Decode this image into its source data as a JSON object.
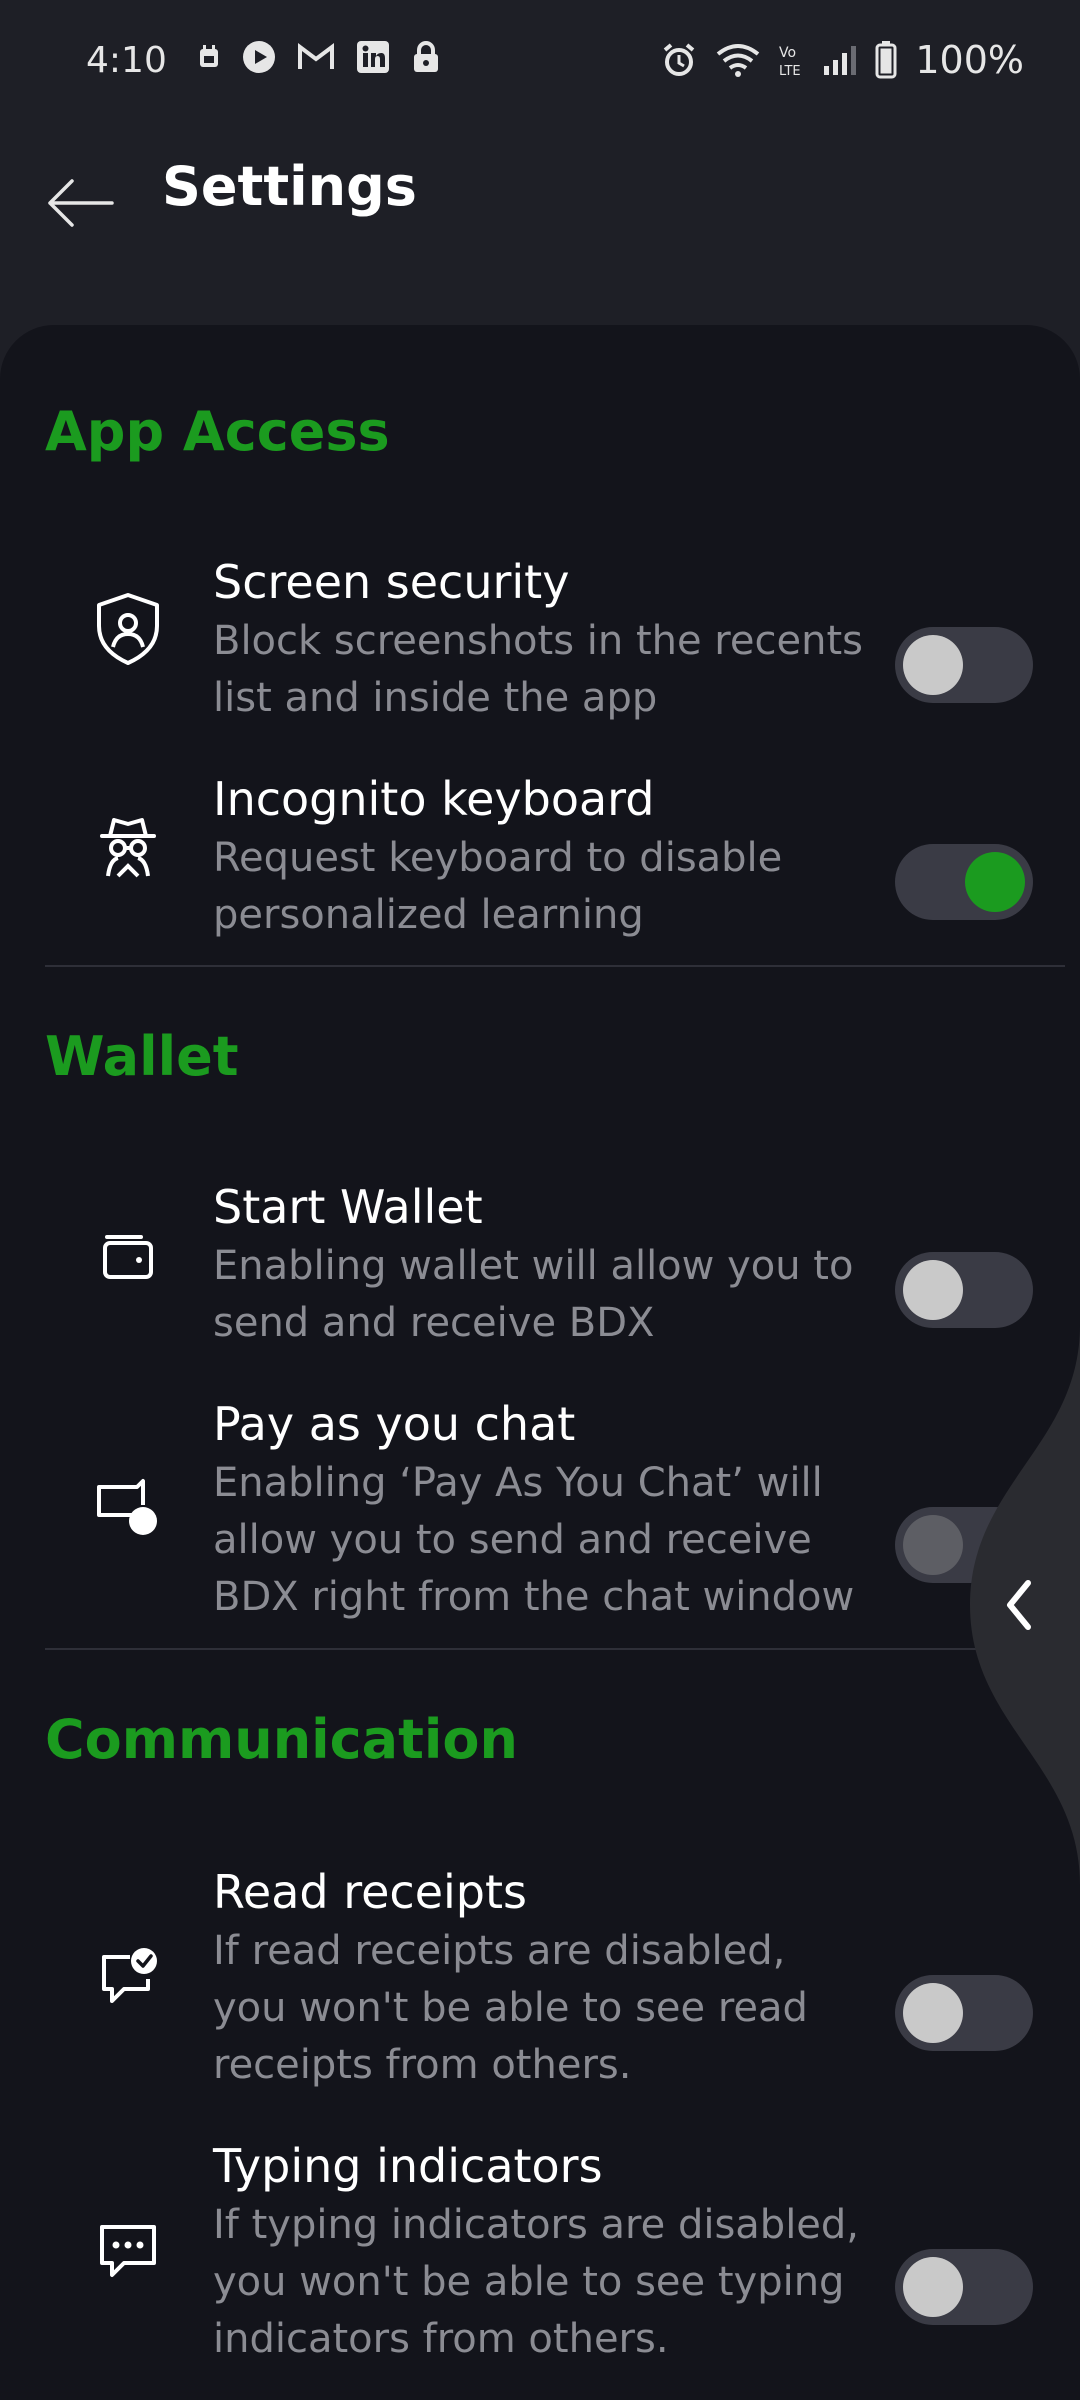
{
  "status_bar": {
    "time": "4:10",
    "notification_icons": [
      "calendar-icon",
      "youtube-icon",
      "gmail-icon",
      "linkedin-icon",
      "lock-icon"
    ],
    "system_icons": [
      "alarm-icon",
      "wifi-icon",
      "volte-icon",
      "signal-icon",
      "battery-icon"
    ],
    "battery": "100%"
  },
  "header": {
    "title": "Settings",
    "back_icon": "arrow-left-icon"
  },
  "sections": [
    {
      "title": "App Access",
      "items": [
        {
          "icon": "shield-user-icon",
          "title": "Screen security",
          "description": "Block screenshots in the recents\nlist and inside the app",
          "toggle": false
        },
        {
          "icon": "incognito-icon",
          "title": "Incognito keyboard",
          "description": "Request keyboard to disable\npersonalized learning",
          "toggle": true
        }
      ]
    },
    {
      "title": "Wallet",
      "items": [
        {
          "icon": "wallet-icon",
          "title": "Start Wallet",
          "description": "Enabling wallet will allow you to\nsend and receive BDX",
          "toggle": false
        },
        {
          "icon": "pay-chat-icon",
          "title": "Pay as you chat",
          "description": "Enabling ‘Pay As You Chat’ will\nallow you to send and receive\nBDX right from the chat window",
          "toggle": false,
          "disabled": true
        }
      ]
    },
    {
      "title": "Communication",
      "items": [
        {
          "icon": "read-receipt-icon",
          "title": "Read receipts",
          "description": "If read receipts are disabled,\nyou won't be able to see read\nreceipts from others.",
          "toggle": false
        },
        {
          "icon": "typing-icon",
          "title": "Typing indicators",
          "description": "If typing indicators are disabled,\nyou won't be able to see typing\nindicators from others.",
          "toggle": false
        }
      ]
    }
  ],
  "edge_panel": {
    "icon": "chevron-left-icon"
  },
  "colors": {
    "accent": "#1b9b1f",
    "background": "#13141b",
    "header_background": "#1e1f26",
    "text_primary": "#ffffff",
    "text_secondary": "#8b8c93"
  }
}
